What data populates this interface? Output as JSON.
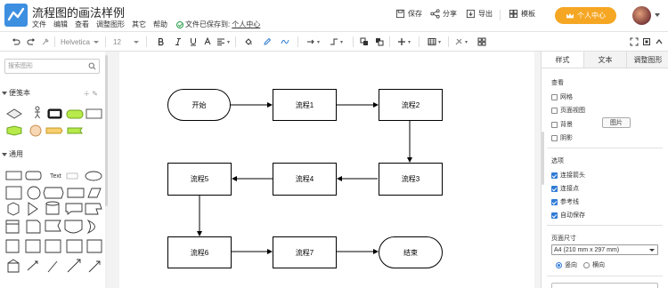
{
  "app": {
    "title": "流程图的画法样例",
    "menu": [
      "文件",
      "编辑",
      "查看",
      "调整图形",
      "其它",
      "帮助"
    ],
    "saved_text": "文件已保存到:",
    "saved_link": "个人中心",
    "actions": {
      "save": "保存",
      "share": "分享",
      "export": "导出",
      "template": "模板"
    },
    "vip_label": "个人中心"
  },
  "toolbar": {
    "font": "Helvetica",
    "font_size": "12"
  },
  "left_panel": {
    "search_placeholder": "搜索图形",
    "section_scratchpad": "便笺本",
    "section_general": "通用",
    "text_shape_label": "Text"
  },
  "diagram": {
    "nodes": {
      "start": "开始",
      "p1": "流程1",
      "p2": "流程2",
      "p3": "流程3",
      "p4": "流程4",
      "p5": "流程5",
      "p6": "流程6",
      "p7": "流程7",
      "end": "结束"
    }
  },
  "right_panel": {
    "tabs": [
      "样式",
      "文本",
      "调整图形"
    ],
    "view_label": "查看",
    "view_options": [
      {
        "label": "网格",
        "checked": false
      },
      {
        "label": "页面视图",
        "checked": false
      },
      {
        "label": "背景",
        "checked": false
      },
      {
        "label": "阴影",
        "checked": false
      }
    ],
    "image_button": "图片",
    "options_label": "选项",
    "options": [
      {
        "label": "连接箭头",
        "checked": true
      },
      {
        "label": "连接点",
        "checked": true
      },
      {
        "label": "参考线",
        "checked": true
      },
      {
        "label": "自动保存",
        "checked": true
      }
    ],
    "page_size_label": "页面尺寸",
    "page_size_value": "A4 (210 mm x 297 mm)",
    "orientation": {
      "portrait": "竖向",
      "landscape": "横向",
      "selected": "portrait"
    }
  },
  "colors": {
    "accent": "#3d8fe0",
    "vip": "#f5a623",
    "check": "#2f7bd6",
    "saved": "#2aa14a"
  }
}
